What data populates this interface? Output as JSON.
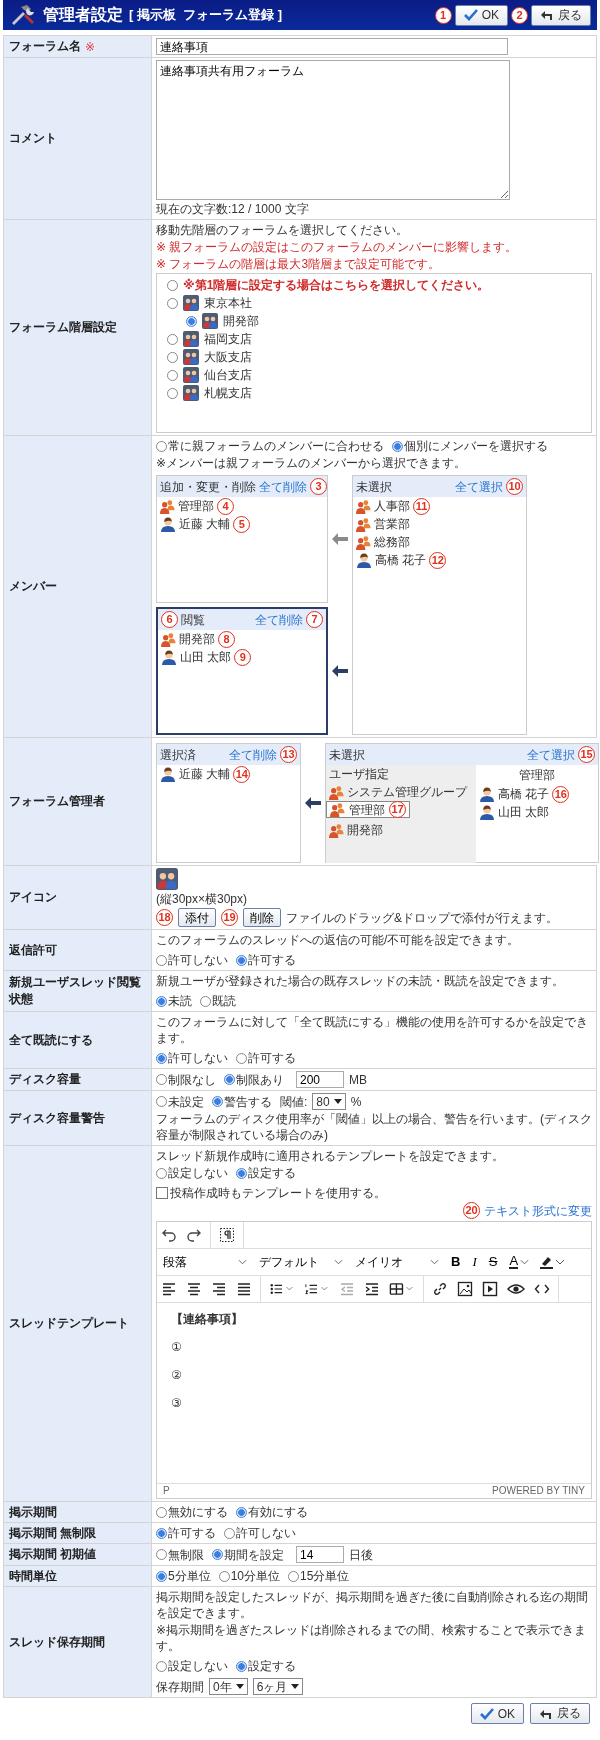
{
  "header": {
    "title": "管理者設定",
    "subtitle": "[ 掲示板  フォーラム登録 ]",
    "buttons": [
      {
        "kind": "ok",
        "label": "OK",
        "callout": "1"
      },
      {
        "kind": "back",
        "label": "戻る",
        "callout": "2"
      }
    ]
  },
  "rows": [
    {
      "kind": "text",
      "label": "フォーラム名",
      "required": "※",
      "value": "連絡事項"
    },
    {
      "kind": "textarea",
      "label": "コメント",
      "value": "連絡事項共有用フォーラム",
      "counter": "現在の文字数:12 / 1000 文字"
    },
    {
      "kind": "hierarchy",
      "label": "フォーラム階層設定",
      "notes": [
        {
          "text": "移動先階層のフォーラムを選択してください。",
          "warning": false
        },
        {
          "text": "※ 親フォーラムの設定はこのフォーラムのメンバーに影響します。",
          "warning": true
        },
        {
          "text": "※ フォーラムの階層は最大3階層まで設定可能です。",
          "warning": true
        }
      ],
      "tree": [
        {
          "kind": "note",
          "label": "※第1階層に設定する場合はこちらを選択してください。",
          "selected": false
        },
        {
          "kind": "forum",
          "label": "東京本社",
          "selected": false,
          "children": [
            {
              "kind": "forum",
              "label": "開発部",
              "selected": true
            }
          ]
        },
        {
          "kind": "forum",
          "label": "福岡支店",
          "selected": false
        },
        {
          "kind": "forum",
          "label": "大阪支店",
          "selected": false
        },
        {
          "kind": "forum",
          "label": "仙台支店",
          "selected": false
        },
        {
          "kind": "forum",
          "label": "札幌支店",
          "selected": false
        }
      ]
    },
    {
      "kind": "members",
      "label": "メンバー",
      "options": [
        {
          "label": "常に親フォーラムのメンバーに合わせる",
          "selected": false
        },
        {
          "label": "個別にメンバーを選択する",
          "selected": true
        }
      ],
      "note": "※メンバーは親フォーラムのメンバーから選択できます。",
      "panels": [
        {
          "title": "追加・変更・削除",
          "action": "全て削除",
          "action_callout": "3",
          "active": false,
          "items": [
            {
              "kind": "group",
              "name": "管理部",
              "callout": "4"
            },
            {
              "kind": "user",
              "name": "近藤 大輔",
              "callout": "5"
            }
          ]
        },
        {
          "title": "閲覧",
          "title_callout": "6",
          "action": "全て削除",
          "action_callout": "7",
          "active": true,
          "items": [
            {
              "kind": "group",
              "name": "開発部",
              "callout": "8"
            },
            {
              "kind": "user",
              "name": "山田 太郎",
              "callout": "9"
            }
          ]
        }
      ],
      "pool": {
        "title": "未選択",
        "action": "全て選択",
        "action_callout": "10",
        "items": [
          {
            "kind": "group",
            "name": "人事部",
            "callout": "11"
          },
          {
            "kind": "group",
            "name": "営業部"
          },
          {
            "kind": "group",
            "name": "総務部"
          },
          {
            "kind": "user",
            "name": "高橋 花子",
            "callout": "12"
          }
        ]
      }
    },
    {
      "kind": "admins",
      "label": "フォーラム管理者",
      "selected_panel": {
        "title": "選択済",
        "action": "全て削除",
        "action_callout": "13",
        "items": [
          {
            "kind": "user",
            "name": "近藤 大輔",
            "callout": "14"
          }
        ]
      },
      "pool": {
        "title": "未選択",
        "action": "全て選択",
        "action_callout": "15",
        "groups_header": "ユーザ指定",
        "groups": [
          {
            "name": "システム管理グループ",
            "selected": false
          },
          {
            "name": "管理部",
            "selected": true,
            "callout": "17"
          },
          {
            "name": "開発部",
            "selected": false
          }
        ],
        "users_header": "管理部",
        "users": [
          {
            "name": "高橋 花子",
            "callout": "16"
          },
          {
            "name": "山田 太郎"
          }
        ]
      }
    },
    {
      "kind": "icon",
      "label": "アイコン",
      "size_note": "(縦30px×横30px)",
      "buttons": [
        {
          "label": "添付",
          "callout": "18"
        },
        {
          "label": "削除",
          "callout": "19"
        }
      ],
      "hint": "ファイルのドラッグ&ドロップで添付が行えます。"
    },
    {
      "kind": "radio",
      "label": "返信許可",
      "description": "このフォーラムのスレッドへの返信の可能/不可能を設定できます。",
      "options": [
        {
          "label": "許可しない",
          "selected": false
        },
        {
          "label": "許可する",
          "selected": true
        }
      ]
    },
    {
      "kind": "radio",
      "label": "新規ユーザスレッド閲覧状態",
      "description": "新規ユーザが登録された場合の既存スレッドの未読・既読を設定できます。",
      "options": [
        {
          "label": "未読",
          "selected": true
        },
        {
          "label": "既読",
          "selected": false
        }
      ]
    },
    {
      "kind": "radio",
      "label": "全て既読にする",
      "description": "このフォーラムに対して「全て既読にする」機能の使用を許可するかを設定できます。",
      "options": [
        {
          "label": "許可しない",
          "selected": true
        },
        {
          "label": "許可する",
          "selected": false
        }
      ]
    },
    {
      "kind": "input",
      "label": "ディスク容量",
      "options": [
        {
          "label": "制限なし",
          "selected": false
        },
        {
          "label": "制限あり",
          "selected": true
        }
      ],
      "value": "200",
      "unit": "MB"
    },
    {
      "kind": "disk_warning",
      "label": "ディスク容量警告",
      "options": [
        {
          "label": "未設定",
          "selected": false
        },
        {
          "label": "警告する",
          "selected": true
        }
      ],
      "threshold_label": "閾値:",
      "threshold": "80",
      "unit": "%",
      "description": "フォーラムのディスク使用率が「閾値」以上の場合、警告を行います。(ディスク容量が制限されている場合のみ)"
    },
    {
      "kind": "template",
      "label": "スレッドテンプレート",
      "description": "スレッド新規作成時に適用されるテンプレートを設定できます。",
      "options": [
        {
          "label": "設定しない",
          "selected": false
        },
        {
          "label": "設定する",
          "selected": true
        }
      ],
      "checkbox": {
        "label": "投稿作成時もテンプレートを使用する。",
        "checked": false
      },
      "link": {
        "label": "テキスト形式に変更",
        "callout": "20"
      },
      "editor": {
        "selects": [
          "段落",
          "デフォルト",
          "メイリオ"
        ],
        "format_buttons": [
          {
            "kind": "bold",
            "label": "B"
          },
          {
            "kind": "italic",
            "label": "I"
          },
          {
            "kind": "strike",
            "label": "S"
          },
          {
            "kind": "color",
            "label": "A"
          }
        ],
        "content": [
          {
            "text": "【連絡事項】",
            "bold": true
          },
          {
            "text": "①",
            "bold": false
          },
          {
            "text": "②",
            "bold": false
          },
          {
            "text": "③",
            "bold": false
          }
        ],
        "path": "P",
        "brand": "POWERED BY TINY"
      }
    },
    {
      "kind": "radio",
      "label": "掲示期間",
      "options": [
        {
          "label": "無効にする",
          "selected": false
        },
        {
          "label": "有効にする",
          "selected": true
        }
      ]
    },
    {
      "kind": "radio",
      "label": "掲示期間 無制限",
      "options": [
        {
          "label": "許可する",
          "selected": true
        },
        {
          "label": "許可しない",
          "selected": false
        }
      ]
    },
    {
      "kind": "input",
      "label": "掲示期間 初期値",
      "options": [
        {
          "label": "無制限",
          "selected": false
        },
        {
          "label": "期間を設定",
          "selected": true
        }
      ],
      "value": "14",
      "unit": "日後"
    },
    {
      "kind": "radio",
      "label": "時間単位",
      "options": [
        {
          "label": "5分単位",
          "selected": true
        },
        {
          "label": "10分単位",
          "selected": false
        },
        {
          "label": "15分単位",
          "selected": false
        }
      ]
    },
    {
      "kind": "retention",
      "label": "スレッド保存期間",
      "descriptions": [
        "掲示期間を設定したスレッドが、掲示期間を過ぎた後に自動削除される迄の期間を設定できます。",
        "※掲示期間を過ぎたスレッドは削除されるまでの間、検索することで表示できます。"
      ],
      "options": [
        {
          "label": "設定しない",
          "selected": false
        },
        {
          "label": "設定する",
          "selected": true
        }
      ],
      "period_label": "保存期間",
      "selects": [
        "0年",
        "6ヶ月"
      ]
    }
  ],
  "footer": {
    "buttons": [
      {
        "kind": "ok",
        "label": "OK"
      },
      {
        "kind": "back",
        "label": "戻る"
      }
    ]
  }
}
